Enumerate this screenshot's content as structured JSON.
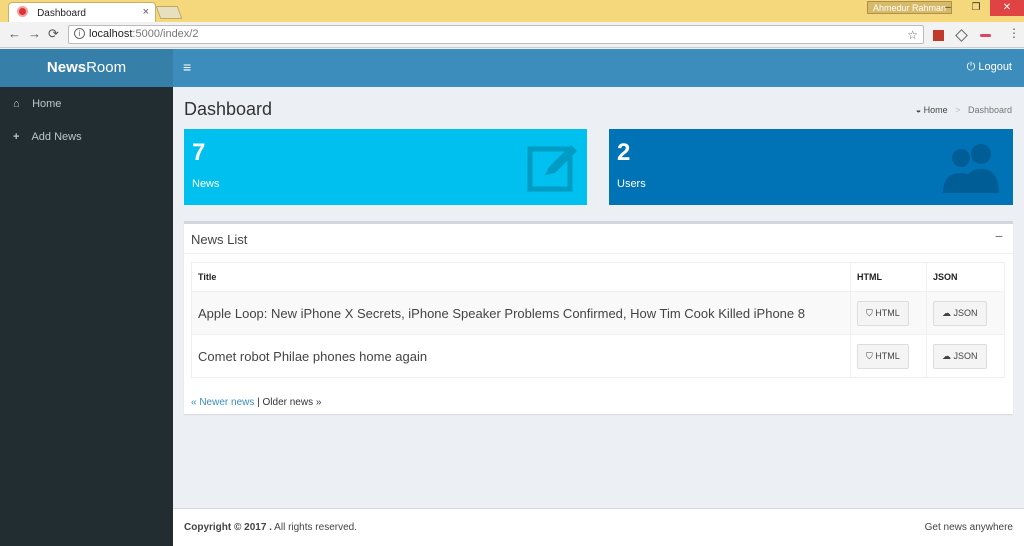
{
  "browser": {
    "tab_title": "Dashboard",
    "tab_close": "×",
    "url_host": "localhost",
    "url_rest": ":5000/index/2",
    "user_name": "Ahmedur Rahman",
    "back": "←",
    "forward": "→",
    "reload": "⟳",
    "star": "☆",
    "menu": "⋮",
    "min": "–",
    "max": "❐",
    "close": "✕"
  },
  "app": {
    "brand_bold": "News",
    "brand_rest": "Room",
    "logout_label": "Logout",
    "hamburger": "≡"
  },
  "sidebar": {
    "items": [
      {
        "icon": "home-icon",
        "glyph": "⌂",
        "label": "Home"
      },
      {
        "icon": "plus-icon",
        "glyph": "+",
        "label": "Add News"
      }
    ]
  },
  "page": {
    "title": "Dashboard",
    "breadcrumb": {
      "home": "Home",
      "sep": ">",
      "current": "Dashboard"
    }
  },
  "stats": [
    {
      "value": "7",
      "label": "News",
      "color": "#00c0ef",
      "icon": "edit-icon"
    },
    {
      "value": "2",
      "label": "Users",
      "color": "#0073b7",
      "icon": "users-icon"
    }
  ],
  "news_list": {
    "title": "News List",
    "collapse": "−",
    "columns": [
      "Title",
      "HTML",
      "JSON"
    ],
    "rows": [
      {
        "title": "Apple Loop: New iPhone X Secrets, iPhone Speaker Problems Confirmed, How Tim Cook Killed iPhone 8",
        "html": "HTML",
        "json": "JSON"
      },
      {
        "title": "Comet robot Philae phones home again",
        "html": "HTML",
        "json": "JSON"
      }
    ],
    "pager": {
      "newer": "« Newer news",
      "sep": " | ",
      "older": "Older news »"
    }
  },
  "footer": {
    "copyright": "Copyright © 2017 .",
    "rights": " All rights reserved.",
    "tagline": "Get news anywhere"
  }
}
